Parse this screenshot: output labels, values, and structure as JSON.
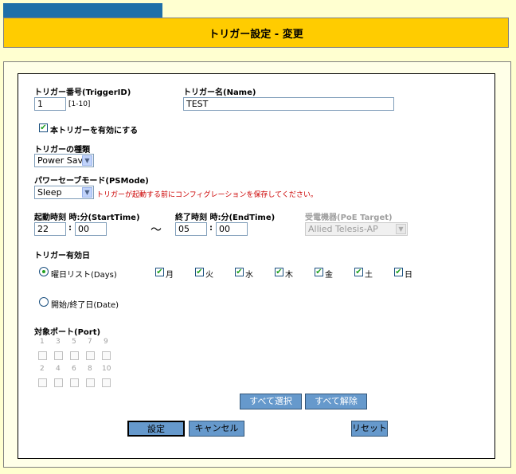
{
  "header": {
    "title": "トリガー設定 - 変更"
  },
  "form": {
    "trigger_id": {
      "label": "トリガー番号(TriggerID)",
      "value": "1",
      "range": "[1-10]"
    },
    "trigger_name": {
      "label": "トリガー名(Name)",
      "value": "TEST"
    },
    "enable": {
      "label": "本トリガーを有効にする",
      "checked": true
    },
    "trigger_type": {
      "label": "トリガーの種類",
      "value": "Power Save"
    },
    "ps_mode": {
      "label": "パワーセーブモード(PSMode)",
      "value": "Sleep",
      "note": "トリガーが起動する前にコンフィグレーションを保存してください。"
    },
    "start_time": {
      "label": "起動時刻 時:分(StartTime)",
      "hour": "22",
      "minute": "00",
      "sep": ":"
    },
    "tilde": "〜",
    "end_time": {
      "label": "終了時刻 時:分(EndTime)",
      "hour": "05",
      "minute": "00",
      "sep": ":"
    },
    "poe_target": {
      "label": "受電機器(PoE Target)",
      "value": "Allied Telesis-AP"
    },
    "days_section": {
      "label": "トリガー有効日"
    },
    "days_radio": {
      "label": "曜日リスト(Days)",
      "selected": true
    },
    "days": [
      "月",
      "火",
      "水",
      "木",
      "金",
      "土",
      "日"
    ],
    "date_radio": {
      "label": "開始/終了日(Date)",
      "selected": false
    },
    "port_section": {
      "label": "対象ポート(Port)"
    },
    "ports_row1": [
      "1",
      "3",
      "5",
      "7",
      "9"
    ],
    "ports_row2": [
      "2",
      "4",
      "6",
      "8",
      "10"
    ]
  },
  "buttons": {
    "select_all": "すべて選択",
    "clear_all": "すべて解除",
    "submit": "設定",
    "cancel": "キャンセル",
    "reset": "リセット"
  }
}
